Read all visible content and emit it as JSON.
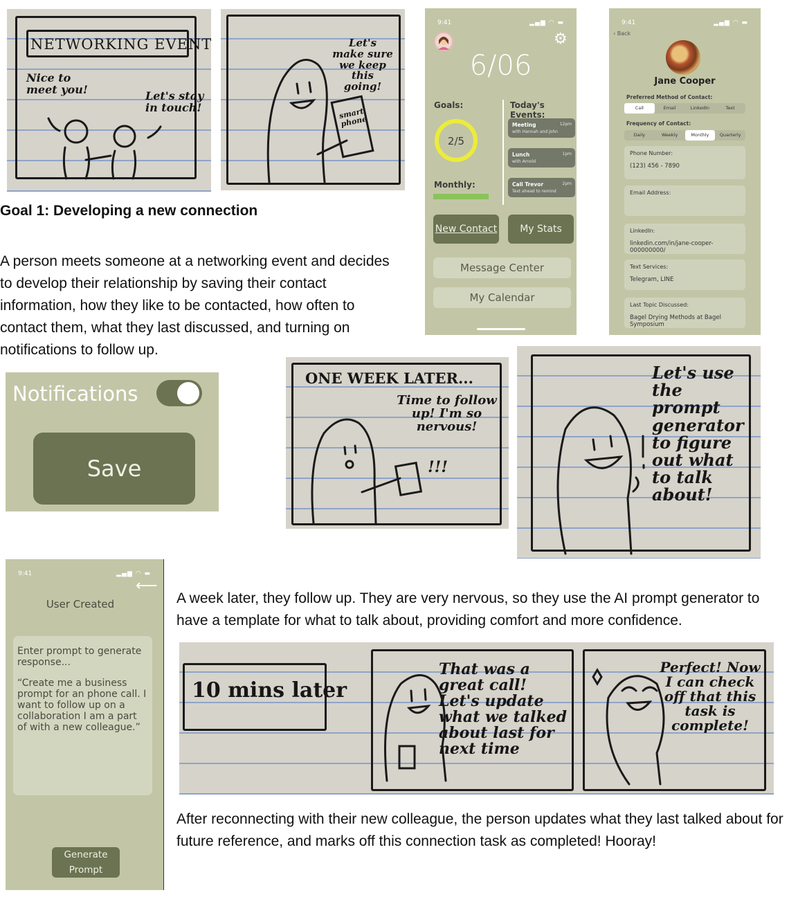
{
  "goal_heading": "Goal 1: Developing a new connection",
  "intro_paragraph": "A person meets someone at a networking event and decides to develop their relationship by saving their contact information, how they like to be contacted, how often to contact them, what they last discussed, and turning on notifications to follow up.",
  "sketch1": {
    "sign": "NETWORKING EVENT",
    "left_speech": "Nice to meet you!",
    "right_speech": "Let's stay in touch!"
  },
  "sketch2": {
    "speech": "Let's make sure we keep this going!",
    "phone_label": "smart phone"
  },
  "home_screen": {
    "status_time": "9:41",
    "date": "6/06",
    "goals_label": "Goals:",
    "goals_value": "2/5",
    "goals_progress": 0.4,
    "monthly_label": "Monthly:",
    "events_label": "Today's Events:",
    "events": [
      {
        "title": "Meeting",
        "sub": "with Hannah and John",
        "time": "12pm"
      },
      {
        "title": "Lunch",
        "sub": "with Arnold",
        "time": "1pm"
      },
      {
        "title": "Call Trevor",
        "sub": "Text ahead to remind",
        "time": "2pm"
      }
    ],
    "new_contact": "New Contact",
    "my_stats": "My Stats",
    "message_center": "Message Center",
    "my_calendar": "My Calendar",
    "colors": {
      "background": "#c2c6a6",
      "dark_button": "#6b7352",
      "goal_ring": "#ecec3a",
      "monthly_bar": "#8ac35a"
    }
  },
  "contact_screen": {
    "status_time": "9:41",
    "back": "Back",
    "name": "Jane Cooper",
    "preferred_label": "Preferred Method of Contact:",
    "preferred_options": [
      "Call",
      "Email",
      "LinkedIn",
      "Text"
    ],
    "preferred_selected": "Call",
    "frequency_label": "Frequency of Contact:",
    "frequency_options": [
      "Daily",
      "Weekly",
      "Monthly",
      "Quarterly"
    ],
    "frequency_selected": "Monthly",
    "phone_label": "Phone Number:",
    "phone_value": "(123) 456 - 7890",
    "email_label": "Email Address:",
    "linkedin_label": "LinkedIn:",
    "linkedin_value": "linkedin.com/in/jane-cooper-000000000/",
    "text_label": "Text Services:",
    "text_value": "Telegram, LINE",
    "topic_label": "Last Topic Discussed:",
    "topic_value": "Bagel Drying Methods at Bagel Symposium"
  },
  "notifications_widget": {
    "label": "Notifications",
    "enabled": true,
    "save": "Save"
  },
  "sketch3": {
    "caption": "ONE WEEK LATER...",
    "speech": "Time to follow up! I'm so nervous!",
    "exclaim": "!!!"
  },
  "sketch4": {
    "speech": "Let's use the prompt generator to figure out what to talk about!"
  },
  "prompt_screen": {
    "status_time": "9:41",
    "title": "User Created",
    "prompt_label": "Enter prompt to generate response...",
    "prompt_value": "“Create me a business prompt for an phone call. I want to follow up on a collaboration I am a part of with a new colleague.”",
    "generate": "Generate Prompt"
  },
  "followup_paragraph": "A week later, they follow up. They are very nervous, so they use the AI prompt generator to have a template for what to talk about, providing comfort and more confidence.",
  "sketch5": {
    "caption": "10 mins later",
    "speech_middle": "That was a great call! Let's update what we talked about last for next time",
    "speech_right": "Perfect! Now I can check off that this task is complete!"
  },
  "final_paragraph": "After reconnecting with their new colleague, the person updates what they last talked about for future reference, and marks off this connection task as completed! Hooray!"
}
